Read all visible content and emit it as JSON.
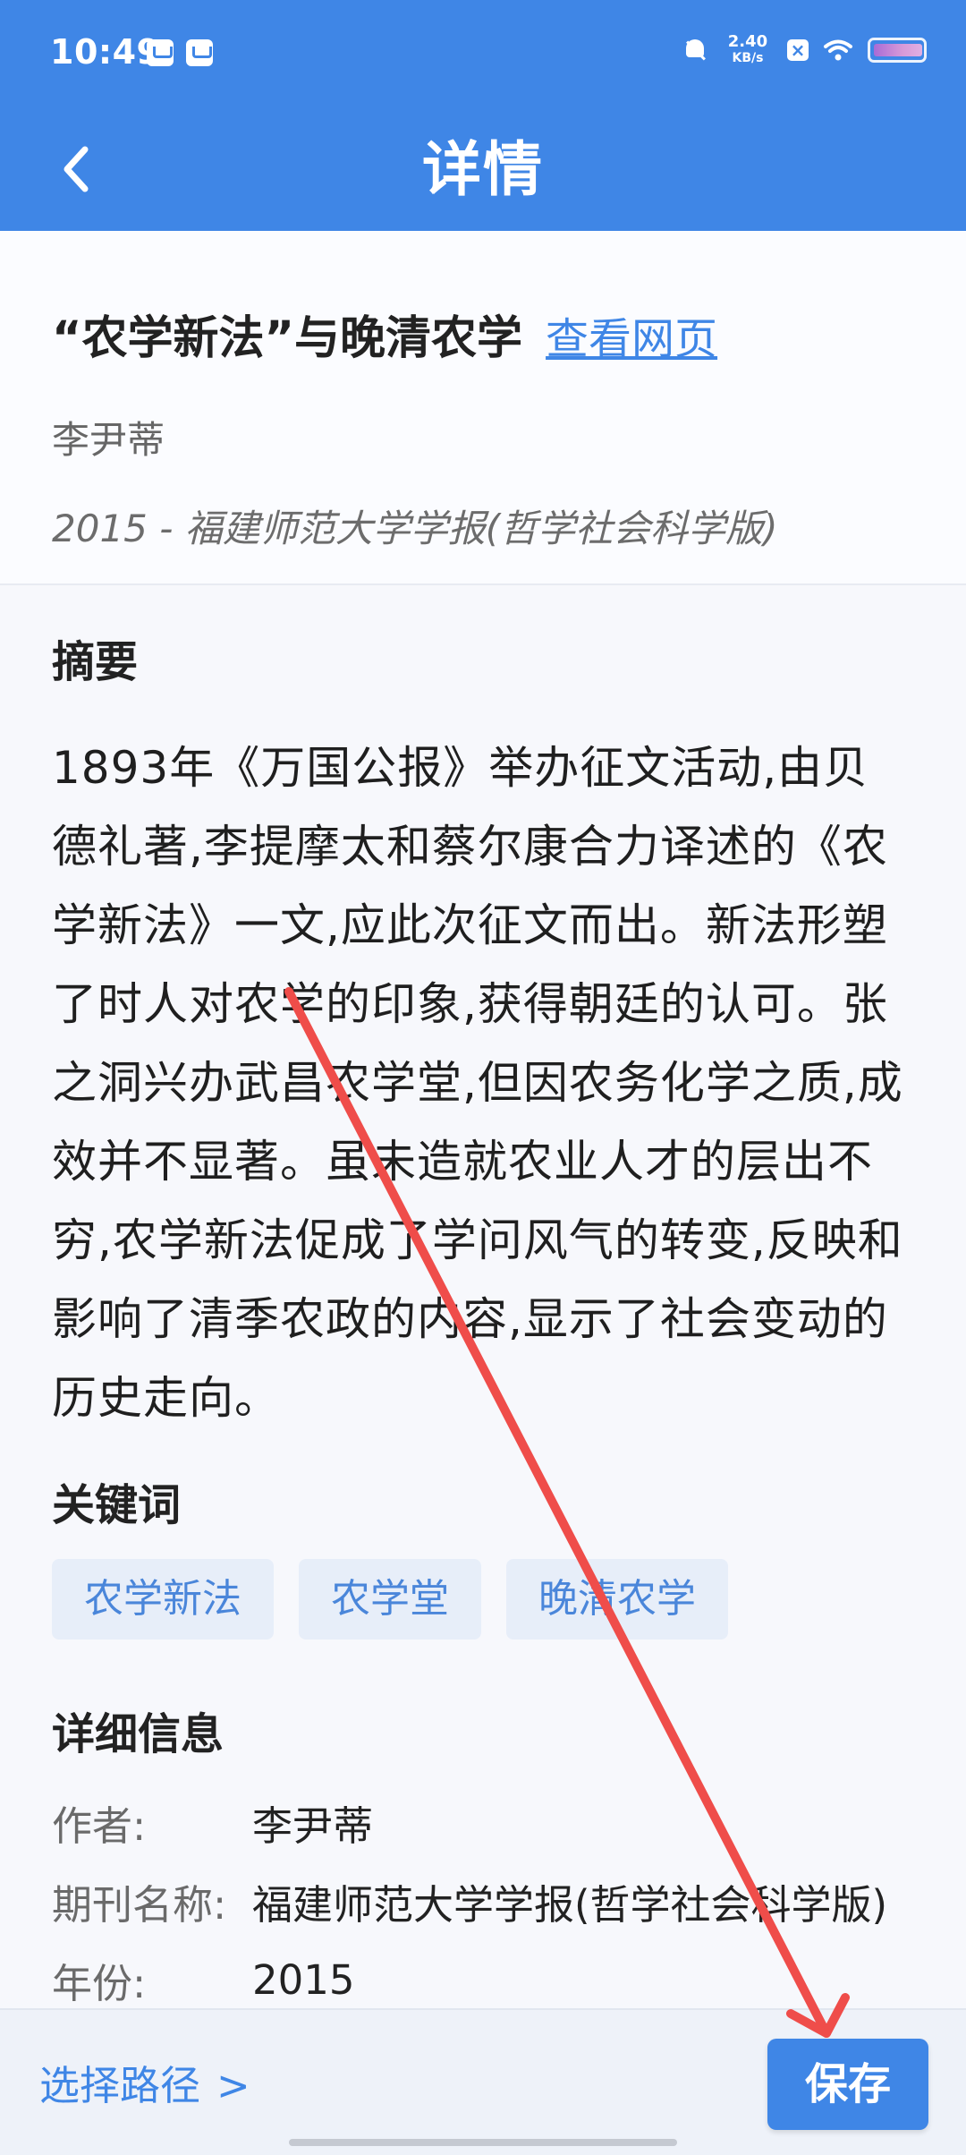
{
  "status_bar": {
    "time": "10:49",
    "network_speed": "2.40",
    "network_unit": "KB/s"
  },
  "nav": {
    "title": "详情"
  },
  "article": {
    "title": "“农学新法”与晚清农学",
    "view_webpage_label": "查看网页",
    "author": "李尹蒂",
    "publication": "2015 - 福建师范大学学报(哲学社会科学版)"
  },
  "abstract": {
    "heading": "摘要",
    "text": "1893年《万国公报》举办征文活动,由贝德礼著,李提摩太和蔡尔康合力译述的《农学新法》一文,应此次征文而出。新法形塑了时人对农学的印象,获得朝廷的认可。张之洞兴办武昌农学堂,但因农务化学之质,成效并不显著。虽未造就农业人才的层出不穷,农学新法促成了学问风气的转变,反映和影响了清季农政的内容,显示了社会变动的历史走向。"
  },
  "keywords": {
    "heading": "关键词",
    "items": [
      "农学新法",
      "农学堂",
      "晚清农学"
    ]
  },
  "details": {
    "heading": "详细信息",
    "rows": [
      {
        "label": "作者:",
        "value": "李尹蒂"
      },
      {
        "label": "期刊名称:",
        "value": "福建师范大学学报(哲学社会科学版)"
      },
      {
        "label": "年份:",
        "value": "2015"
      }
    ]
  },
  "bottom_bar": {
    "choose_path_label": "选择路径",
    "choose_path_chevron": ">",
    "save_label": "保存"
  },
  "colors": {
    "primary": "#3f86e6",
    "keyword_bg": "#e7eef9",
    "annotation": "#ef4d4a"
  },
  "icons": {
    "back": "chevron-left-icon",
    "status_left": [
      "calendar-icon",
      "message-icon"
    ],
    "status_right": [
      "bell-off-icon",
      "x-box-icon",
      "wifi-icon",
      "battery-icon"
    ]
  }
}
